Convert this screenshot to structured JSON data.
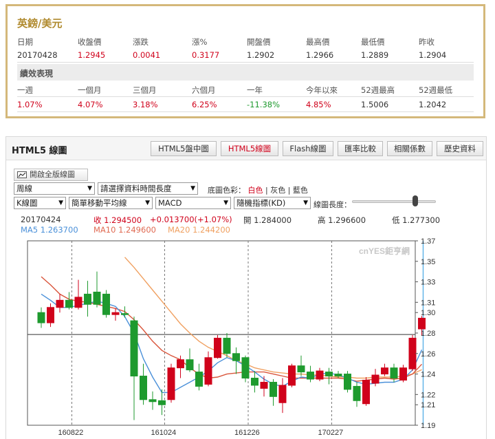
{
  "quote": {
    "title": "英鎊/美元",
    "headers": [
      "日期",
      "收盤價",
      "漲跌",
      "漲%",
      "開盤價",
      "最高價",
      "最低價",
      "昨收"
    ],
    "values": [
      "20170428",
      "1.2945",
      "0.0041",
      "0.3177",
      "1.2902",
      "1.2966",
      "1.2889",
      "1.2904"
    ],
    "section_title": "績效表現",
    "perf_headers": [
      "一週",
      "一個月",
      "三個月",
      "六個月",
      "一年",
      "今年以來",
      "52週最高",
      "52週最低"
    ],
    "perf_values": [
      "1.07%",
      "4.07%",
      "3.18%",
      "6.25%",
      "-11.38%",
      "4.85%",
      "1.5006",
      "1.2042"
    ]
  },
  "panel": {
    "title": "HTML5 線圖",
    "tabs": [
      "HTML5盤中圖",
      "HTML5線圖",
      "Flash線圖",
      "匯率比較",
      "相關係數",
      "歷史資料"
    ],
    "active_tab": 1
  },
  "controls": {
    "open_full": "開啟全版線圖",
    "period": "周線",
    "range": "請選擇資料時間長度",
    "bg_label": "底圖色彩：",
    "bg_white": "白色",
    "bg_gray": "灰色",
    "bg_blue": "藍色",
    "sep": "|",
    "chart_type": "K線圖",
    "ma_type": "簡單移動平均線",
    "indicator": "MACD",
    "indicator2": "隨機指標(KD)",
    "length_label": "線圖長度："
  },
  "info": {
    "date": "20170424",
    "close": "收 1.294500",
    "change": "+0.013700(+1.07%)",
    "open": "開 1.284000",
    "high": "高 1.296600",
    "low": "低 1.277300",
    "ma5": "MA5 1.263700",
    "ma10": "MA10 1.249600",
    "ma20": "MA20 1.244200"
  },
  "colors": {
    "up": "#d0021b",
    "down": "#1e9a2e",
    "ma5": "#4a90d9",
    "ma10": "#d9543a",
    "ma20": "#f0a060",
    "frame": "#bfa260"
  },
  "chart_data": {
    "type": "candlestick",
    "watermark": "cnYES鉅亨網",
    "y_ticks": [
      1.37,
      1.35,
      1.33,
      1.31,
      1.3,
      1.28,
      1.26,
      1.24,
      1.22,
      1.21,
      1.19
    ],
    "ylim": [
      1.19,
      1.37
    ],
    "x_ticks": [
      "160822",
      "161024",
      "161226",
      "170227"
    ],
    "reference_price": 1.2786,
    "candles": [
      [
        1.3,
        1.29,
        1.305,
        1.285
      ],
      [
        1.29,
        1.305,
        1.309,
        1.286
      ],
      [
        1.305,
        1.312,
        1.318,
        1.3
      ],
      [
        1.312,
        1.305,
        1.32,
        1.303
      ],
      [
        1.305,
        1.315,
        1.332,
        1.303
      ],
      [
        1.318,
        1.308,
        1.331,
        1.296
      ],
      [
        1.32,
        1.308,
        1.34,
        1.305
      ],
      [
        1.318,
        1.298,
        1.322,
        1.295
      ],
      [
        1.298,
        1.3,
        1.304,
        1.292
      ],
      [
        1.299,
        1.298,
        1.306,
        1.295
      ],
      [
        1.292,
        1.238,
        1.296,
        1.195
      ],
      [
        1.238,
        1.215,
        1.25,
        1.21
      ],
      [
        1.215,
        1.213,
        1.223,
        1.205
      ],
      [
        1.214,
        1.21,
        1.225,
        1.2
      ],
      [
        1.215,
        1.246,
        1.25,
        1.212
      ],
      [
        1.246,
        1.254,
        1.258,
        1.236
      ],
      [
        1.254,
        1.244,
        1.265,
        1.242
      ],
      [
        1.242,
        1.228,
        1.25,
        1.224
      ],
      [
        1.23,
        1.256,
        1.262,
        1.228
      ],
      [
        1.256,
        1.275,
        1.278,
        1.255
      ],
      [
        1.275,
        1.26,
        1.28,
        1.256
      ],
      [
        1.26,
        1.253,
        1.266,
        1.24
      ],
      [
        1.256,
        1.236,
        1.258,
        1.232
      ],
      [
        1.236,
        1.229,
        1.243,
        1.222
      ],
      [
        1.226,
        1.232,
        1.238,
        1.218
      ],
      [
        1.232,
        1.218,
        1.235,
        1.209
      ],
      [
        1.212,
        1.229,
        1.236,
        1.202
      ],
      [
        1.229,
        1.248,
        1.25,
        1.227
      ],
      [
        1.248,
        1.242,
        1.258,
        1.238
      ],
      [
        1.242,
        1.235,
        1.248,
        1.232
      ],
      [
        1.235,
        1.243,
        1.246,
        1.233
      ],
      [
        1.242,
        1.238,
        1.246,
        1.23
      ],
      [
        1.24,
        1.238,
        1.243,
        1.236
      ],
      [
        1.24,
        1.225,
        1.243,
        1.222
      ],
      [
        1.228,
        1.214,
        1.232,
        1.208
      ],
      [
        1.211,
        1.234,
        1.237,
        1.209
      ],
      [
        1.231,
        1.239,
        1.245,
        1.228
      ],
      [
        1.24,
        1.246,
        1.25,
        1.238
      ],
      [
        1.246,
        1.236,
        1.25,
        1.232
      ],
      [
        1.234,
        1.246,
        1.249,
        1.232
      ],
      [
        1.245,
        1.275,
        1.278,
        1.243
      ],
      [
        1.284,
        1.2945,
        1.2966,
        1.2773
      ]
    ],
    "ma5": [
      1.318,
      1.312,
      1.305,
      1.305,
      1.307,
      1.309,
      1.311,
      1.309,
      1.306,
      1.296,
      1.28,
      1.255,
      1.237,
      1.222,
      1.222,
      1.227,
      1.232,
      1.237,
      1.243,
      1.251,
      1.256,
      1.253,
      1.248,
      1.242,
      1.235,
      1.23,
      1.228,
      1.233,
      1.237,
      1.236,
      1.24,
      1.241,
      1.239,
      1.236,
      1.232,
      1.23,
      1.231,
      1.232,
      1.232,
      1.235,
      1.244,
      1.2637
    ],
    "ma10": [
      1.335,
      1.327,
      1.318,
      1.313,
      1.311,
      1.31,
      1.308,
      1.306,
      1.304,
      1.301,
      1.293,
      1.283,
      1.272,
      1.263,
      1.258,
      1.254,
      1.246,
      1.24,
      1.236,
      1.237,
      1.24,
      1.241,
      1.242,
      1.242,
      1.242,
      1.24,
      1.238,
      1.236,
      1.236,
      1.236,
      1.236,
      1.236,
      1.236,
      1.235,
      1.233,
      1.234,
      1.235,
      1.236,
      1.235,
      1.236,
      1.24,
      1.2496
    ],
    "ma20": [
      null,
      null,
      null,
      null,
      null,
      null,
      null,
      null,
      null,
      1.354,
      1.344,
      1.333,
      1.322,
      1.311,
      1.3,
      1.289,
      1.28,
      1.272,
      1.266,
      1.262,
      1.258,
      1.253,
      1.25,
      1.246,
      1.244,
      1.242,
      1.241,
      1.24,
      1.24,
      1.239,
      1.239,
      1.238,
      1.237,
      1.237,
      1.236,
      1.236,
      1.237,
      1.237,
      1.237,
      1.238,
      1.24,
      1.2442
    ]
  }
}
